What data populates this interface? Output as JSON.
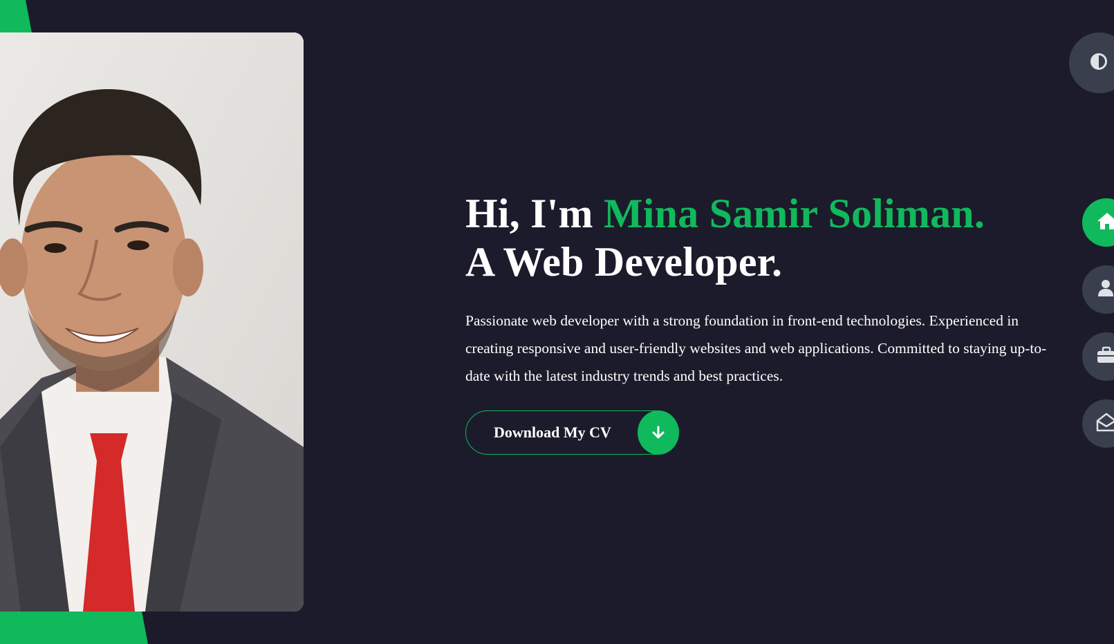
{
  "hero": {
    "greeting": "Hi, I'm ",
    "name": "Mina Samir Soliman.",
    "role": "A Web Developer.",
    "description": "Passionate web developer with a strong foundation in front-end technologies. Experienced in creating responsive and user-friendly websites and web applications. Committed to staying up-to-date with the latest industry trends and best practices.",
    "cv_button_label": "Download My CV",
    "cv_button_icon": "arrow-down-icon"
  },
  "theme_toggle": {
    "icon": "contrast-icon"
  },
  "nav": [
    {
      "name": "home",
      "icon": "home-icon",
      "active": true
    },
    {
      "name": "about",
      "icon": "user-icon",
      "active": false
    },
    {
      "name": "portfolio",
      "icon": "briefcase-icon",
      "active": false
    },
    {
      "name": "contact",
      "icon": "envelope-open-icon",
      "active": false
    }
  ],
  "colors": {
    "background": "#1c1b2b",
    "accent": "#10b95c",
    "nav_button": "#3a3f4d",
    "text": "#ffffff"
  }
}
